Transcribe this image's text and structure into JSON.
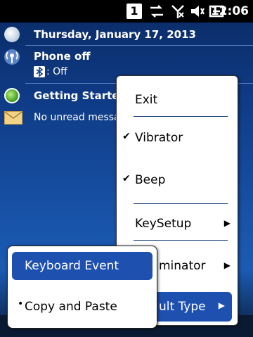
{
  "statusbar": {
    "badge": "1",
    "time": "12:06",
    "icons": [
      "sync-icon",
      "no-signal-icon",
      "speaker-icon",
      "battery-icon"
    ]
  },
  "today": {
    "date": "Thursday, January 17, 2013",
    "phone_title": "Phone off",
    "bluetooth_status": ": Off",
    "getting_started": "Getting Starte",
    "messages": "No unread messa"
  },
  "menu": {
    "exit": "Exit",
    "vibrator": "Vibrator",
    "beep": "Beep",
    "keysetup": "KeySetup",
    "terminator": "minator",
    "result_type": "ult Type"
  },
  "submenu": {
    "keyboard_event": "Keyboard Event",
    "copy_paste": "Copy and Paste"
  },
  "colors": {
    "accent": "#1e50b0",
    "background": "#0f3b86"
  }
}
